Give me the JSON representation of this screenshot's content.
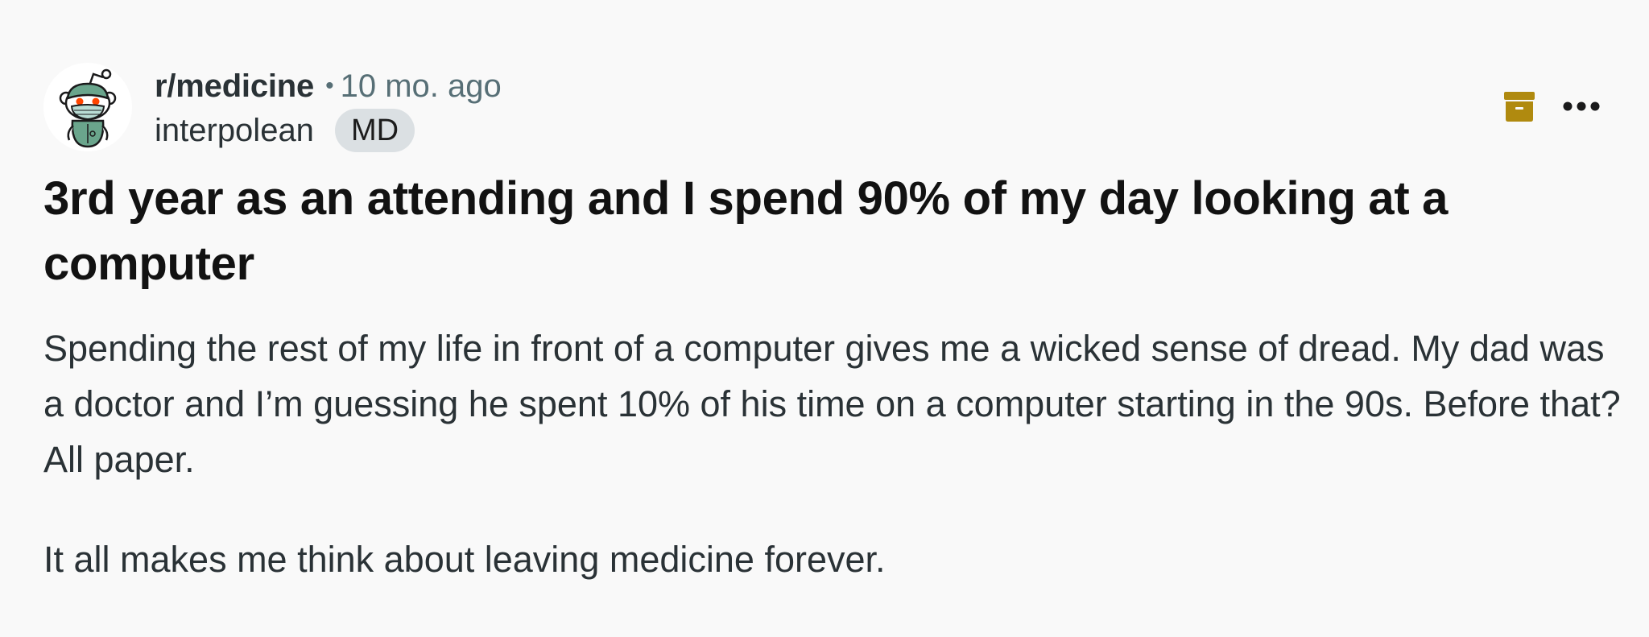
{
  "post": {
    "subreddit": "r/medicine",
    "separator": "•",
    "time": "10 mo. ago",
    "username": "interpolean",
    "flair": "MD",
    "title": "3rd year as an attending and I spend 90% of my day looking at a computer",
    "body": [
      "Spending the rest of my life in front of a computer gives me a wicked sense of dread. My dad was a doctor and I’m guessing he spent 10% of his time on a computer starting in the 90s. Before that? All paper.",
      "It all makes me think about leaving medicine forever."
    ]
  },
  "icons": {
    "avatar": "reddit-snoo-doctor-avatar",
    "archive": "archive-icon",
    "more": "more-options-icon"
  },
  "colors": {
    "background": "#f9f9f9",
    "archive_icon": "#b08a0f",
    "flair_background": "#dbe0e3",
    "meta_text": "#576f76"
  }
}
